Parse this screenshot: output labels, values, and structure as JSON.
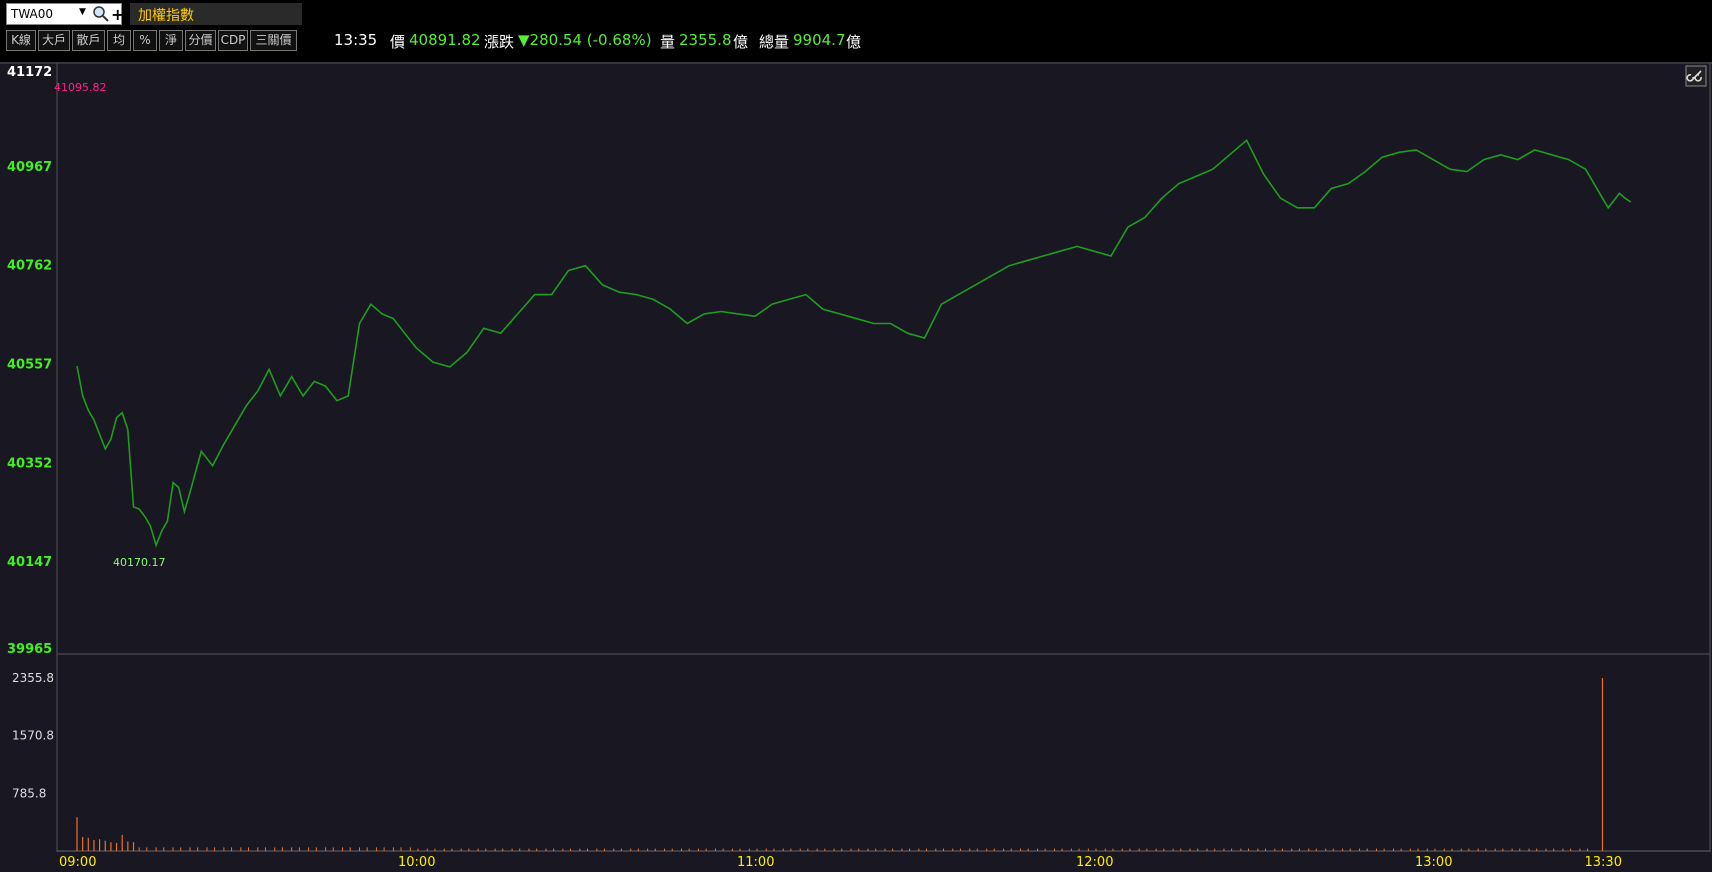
{
  "header": {
    "symbol": "TWA00",
    "dropdown_icon": "chevron-down-icon",
    "search_icon": "search-icon",
    "add_icon": "plus-icon",
    "name": "加權指數"
  },
  "toolbar": {
    "buttons": [
      "K線",
      "大戶",
      "散戶",
      "均",
      "%",
      "淨",
      "分價",
      "CDP",
      "三關價"
    ]
  },
  "quote": {
    "time": "13:35",
    "price_label": "價",
    "price": "40891.82",
    "change_label": "漲跌",
    "change": "▼280.54 (-0.68%)",
    "volume_label": "量",
    "volume": "2355.8",
    "volume_unit": "億",
    "total_label": "總量",
    "total": "9904.7",
    "total_unit": "億"
  },
  "link_icon": "link-icon",
  "colors": {
    "line": "#1e9e1e",
    "up_axis": "#44ee22",
    "bar": "#e8742c",
    "high_label": "#ff2288",
    "low_label": "#88ff66",
    "time_axis": "#ffee00",
    "background": "#181722"
  },
  "chart_data": [
    {
      "type": "line",
      "title": "",
      "ylim": [
        39965,
        41172
      ],
      "y_ticks": [
        "41172",
        "40967",
        "40762",
        "40557",
        "40352",
        "40147",
        "39965"
      ],
      "high_label": "41095.82",
      "low_label": "40170.17",
      "x_ticks": [
        "09:00",
        "10:00",
        "11:00",
        "12:00",
        "13:00",
        "13:30"
      ],
      "series": [
        {
          "x": [
            "09:00",
            "09:01",
            "09:02",
            "09:03",
            "09:04",
            "09:05",
            "09:06",
            "09:07",
            "09:08",
            "09:09",
            "09:10",
            "09:11",
            "09:12",
            "09:13",
            "09:14",
            "09:15",
            "09:16",
            "09:17",
            "09:18",
            "09:19",
            "09:20",
            "09:22",
            "09:24",
            "09:26",
            "09:28",
            "09:30",
            "09:32",
            "09:34",
            "09:36",
            "09:38",
            "09:40",
            "09:42",
            "09:44",
            "09:46",
            "09:48",
            "09:50",
            "09:52",
            "09:54",
            "09:56",
            "09:58",
            "10:00",
            "10:03",
            "10:06",
            "10:09",
            "10:12",
            "10:15",
            "10:18",
            "10:21",
            "10:24",
            "10:27",
            "10:30",
            "10:33",
            "10:36",
            "10:39",
            "10:42",
            "10:45",
            "10:48",
            "10:51",
            "10:54",
            "10:57",
            "11:00",
            "11:03",
            "11:06",
            "11:09",
            "11:12",
            "11:15",
            "11:18",
            "11:21",
            "11:24",
            "11:27",
            "11:30",
            "11:33",
            "11:36",
            "11:39",
            "11:42",
            "11:45",
            "11:48",
            "11:51",
            "11:54",
            "11:57",
            "12:00",
            "12:03",
            "12:06",
            "12:09",
            "12:12",
            "12:15",
            "12:18",
            "12:21",
            "12:24",
            "12:27",
            "12:30",
            "12:33",
            "12:36",
            "12:39",
            "12:42",
            "12:45",
            "12:48",
            "12:51",
            "12:54",
            "12:57",
            "13:00",
            "13:03",
            "13:06",
            "13:09",
            "13:12",
            "13:15",
            "13:18",
            "13:21",
            "13:24",
            "13:27",
            "13:30",
            "13:31",
            "13:32",
            "13:33",
            "13:34",
            "13:35"
          ],
          "values": [
            40552,
            40490,
            40460,
            40440,
            40410,
            40380,
            40400,
            40445,
            40455,
            40420,
            40260,
            40255,
            40240,
            40220,
            40180,
            40210,
            40230,
            40310,
            40300,
            40250,
            40290,
            40375,
            40345,
            40390,
            40430,
            40470,
            40500,
            40545,
            40490,
            40530,
            40490,
            40520,
            40510,
            40480,
            40490,
            40640,
            40680,
            40660,
            40650,
            40620,
            40590,
            40560,
            40550,
            40580,
            40630,
            40620,
            40660,
            40700,
            40700,
            40750,
            40760,
            40720,
            40705,
            40700,
            40690,
            40670,
            40640,
            40660,
            40665,
            40660,
            40655,
            40680,
            40690,
            40700,
            40670,
            40660,
            40650,
            40640,
            40640,
            40620,
            40610,
            40680,
            40700,
            40720,
            40740,
            40760,
            40770,
            40780,
            40790,
            40800,
            40790,
            40780,
            40840,
            40860,
            40900,
            40930,
            40945,
            40960,
            40990,
            41020,
            40950,
            40900,
            40880,
            40880,
            40920,
            40930,
            40955,
            40985,
            40995,
            41000,
            40980,
            40960,
            40955,
            40980,
            40990,
            40980,
            41000,
            40990,
            40980,
            40960,
            40900,
            40880,
            40895,
            40910,
            40900,
            40892
          ]
        }
      ]
    },
    {
      "type": "bar",
      "title": "",
      "ylim": [
        0,
        2355.8
      ],
      "y_ticks": [
        "2355.8",
        "1570.8",
        "785.8"
      ],
      "x": [
        "09:00",
        "09:01",
        "09:02",
        "09:03",
        "09:04",
        "09:05",
        "09:06",
        "09:07",
        "09:08",
        "09:09",
        "09:10",
        "13:30"
      ],
      "values": [
        460,
        190,
        180,
        150,
        160,
        140,
        120,
        110,
        220,
        130,
        120,
        2355.8
      ],
      "baseline_value": 55
    }
  ]
}
